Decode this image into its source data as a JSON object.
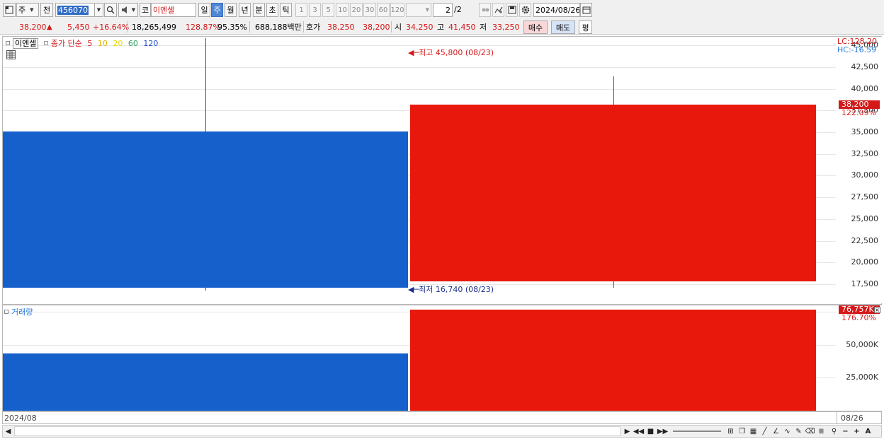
{
  "toolbar": {
    "period_select": "주",
    "prev_label": "전",
    "stock_code": "456070",
    "market_label": "코",
    "stock_name": "이엔셀",
    "period_day": "일",
    "period_week": "주",
    "period_month": "월",
    "period_year": "년",
    "period_minute": "분",
    "period_second": "초",
    "period_tick": "틱",
    "intervals": [
      "1",
      "3",
      "5",
      "10",
      "20",
      "30",
      "60",
      "120"
    ],
    "page_value": "2",
    "page_total": "/2",
    "date_value": "2024/08/26"
  },
  "quote": {
    "price": "38,200",
    "change_arrow": "▲",
    "change": "5,450",
    "change_pct": "+16.64%",
    "volume": "18,265,499",
    "volume_ratio": "128.87%",
    "turnover": "95.35%",
    "amount": "688,188백만",
    "ask_label": "호가",
    "ask1": "38,250",
    "ask2": "38,200",
    "open_label": "시",
    "open": "34,250",
    "high_label": "고",
    "high": "41,450",
    "low_label": "저",
    "low": "33,250",
    "buy_label": "매수",
    "sell_label": "매도",
    "avg_label": "평"
  },
  "price_pane": {
    "stock_label": "이엔셀",
    "ma_label": "종가 단순",
    "ma_periods": [
      "5",
      "10",
      "20",
      "60",
      "120"
    ],
    "ma_colors": [
      "#d51818",
      "#e8b000",
      "#e8d800",
      "#2aa05a",
      "#1f4fcc"
    ],
    "lc_label": "LC:128.20",
    "hc_label": "HC:-16.59",
    "high_annotation": "최고 45,800 (08/23)",
    "low_annotation": "최저 16,740 (08/23)",
    "current_price_tag": "38,200",
    "current_pct": "122.09%",
    "y_ticks": [
      "45,000",
      "42,500",
      "40,000",
      "37,500",
      "35,000",
      "32,500",
      "30,000",
      "27,500",
      "25,000",
      "22,500",
      "20,000",
      "17,500"
    ]
  },
  "volume_pane": {
    "label": "거래량",
    "current_tag": "76,757K",
    "current_pct": "176.70%",
    "y_ticks": [
      "50,000K",
      "25,000K"
    ]
  },
  "x_axis": {
    "start_label": "2024/08",
    "end_label": "08/26"
  },
  "colors": {
    "up": "#e8190c",
    "down": "#1660cc",
    "axis_tag": "#d51818"
  },
  "chart_data": {
    "type": "candlestick",
    "candles": [
      {
        "open": 35100,
        "close": 17100,
        "high": 45800,
        "low": 16740,
        "direction": "down"
      },
      {
        "open": 17800,
        "close": 38200,
        "high": 41450,
        "low": 17100,
        "direction": "up"
      }
    ],
    "volumes": [
      43500,
      76757
    ],
    "ylim_price": [
      15300,
      46000
    ],
    "ylim_volume": [
      0,
      80000
    ]
  }
}
